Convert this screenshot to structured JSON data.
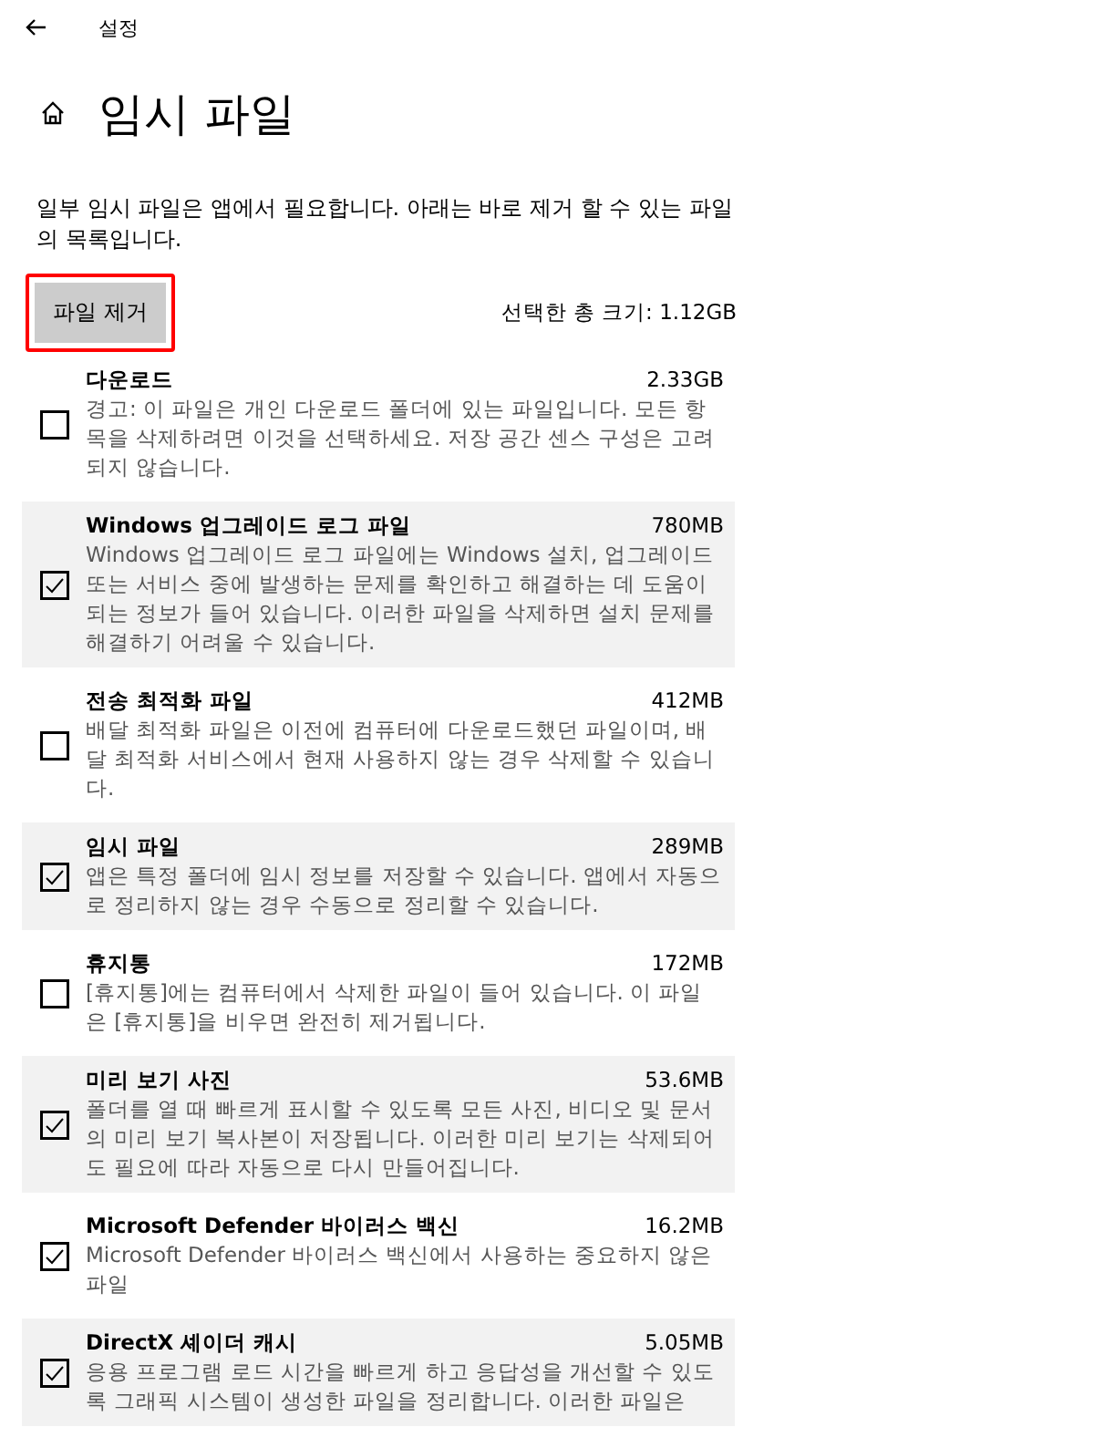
{
  "window": {
    "title": "설정"
  },
  "page": {
    "title": "임시 파일",
    "description": "일부 임시 파일은 앱에서 필요합니다. 아래는 바로 제거 할 수 있는 파일의 목록입니다."
  },
  "remove_button": {
    "label": "파일 제거",
    "highlighted": true
  },
  "total_selected": "선택한 총 크기: 1.12GB",
  "items": [
    {
      "name": "다운로드",
      "size": "2.33GB",
      "description": "경고: 이 파일은 개인 다운로드 폴더에 있는 파일입니다. 모든 항목을 삭제하려면 이것을 선택하세요. 저장 공간 센스 구성은 고려되지 않습니다.",
      "checked": false
    },
    {
      "name": "Windows 업그레이드 로그 파일",
      "size": "780MB",
      "description": "Windows 업그레이드 로그 파일에는 Windows 설치, 업그레이드 또는 서비스 중에 발생하는 문제를 확인하고 해결하는 데 도움이 되는 정보가 들어 있습니다. 이러한 파일을 삭제하면 설치 문제를 해결하기 어려울 수 있습니다.",
      "checked": true
    },
    {
      "name": "전송 최적화 파일",
      "size": "412MB",
      "description": "배달 최적화 파일은 이전에 컴퓨터에 다운로드했던 파일이며, 배달 최적화 서비스에서 현재 사용하지 않는 경우 삭제할 수 있습니다.",
      "checked": false
    },
    {
      "name": "임시 파일",
      "size": "289MB",
      "description": "앱은 특정 폴더에 임시 정보를 저장할 수 있습니다. 앱에서 자동으로 정리하지 않는 경우 수동으로 정리할 수 있습니다.",
      "checked": true
    },
    {
      "name": "휴지통",
      "size": "172MB",
      "description": "[휴지통]에는 컴퓨터에서 삭제한 파일이 들어 있습니다. 이 파일은 [휴지통]을 비우면 완전히 제거됩니다.",
      "checked": false
    },
    {
      "name": "미리 보기 사진",
      "size": "53.6MB",
      "description": "폴더를 열 때 빠르게 표시할 수 있도록 모든 사진, 비디오 및 문서의 미리 보기 복사본이 저장됩니다. 이러한 미리 보기는 삭제되어도 필요에 따라 자동으로 다시 만들어집니다.",
      "checked": true
    },
    {
      "name": "Microsoft Defender 바이러스 백신",
      "size": "16.2MB",
      "description": "Microsoft Defender 바이러스 백신에서 사용하는 중요하지 않은 파일",
      "checked": true
    },
    {
      "name": "DirectX 셰이더 캐시",
      "size": "5.05MB",
      "description": "응용 프로그램 로드 시간을 빠르게 하고 응답성을 개선할 수 있도록 그래픽 시스템이 생성한 파일을 정리합니다. 이러한 파일은",
      "checked": true
    }
  ]
}
